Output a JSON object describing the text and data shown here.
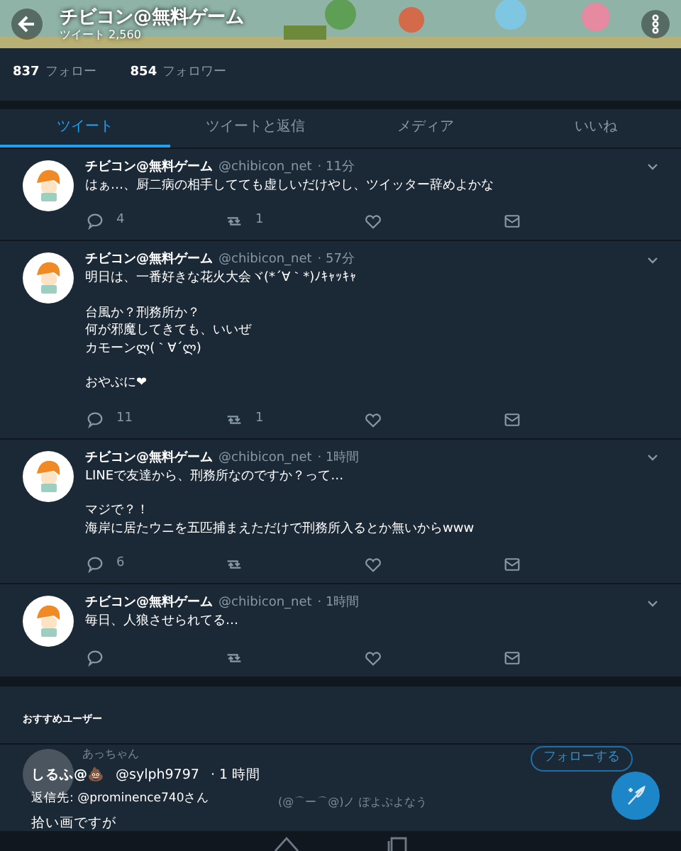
{
  "header": {
    "title": "チビコン@無料ゲーム",
    "subtitle": "ツイート 2,560"
  },
  "stats": [
    {
      "count": "837",
      "label": "フォロー"
    },
    {
      "count": "854",
      "label": "フォロワー"
    }
  ],
  "tabs": [
    {
      "label": "ツイート",
      "selected": true
    },
    {
      "label": "ツイートと返信",
      "selected": false
    },
    {
      "label": "メディア",
      "selected": false
    },
    {
      "label": "いいね",
      "selected": false
    }
  ],
  "tweets": [
    {
      "name": "チビコン@無料ゲーム",
      "handle": "@chibicon_net",
      "time": "· 11分",
      "paragraphs": [
        [
          "はぁ…、厨二病の相手してても虚しいだけやし、ツイッター辞めよかな"
        ]
      ],
      "replies": "4",
      "retweets": "1"
    },
    {
      "name": "チビコン@無料ゲーム",
      "handle": "@chibicon_net",
      "time": "· 57分",
      "paragraphs": [
        [
          "明日は、一番好きな花火大会ヾ(*´∀｀*)ﾉｷｬｯｷｬ"
        ],
        [
          "台風か？刑務所か？",
          "何が邪魔してきても、いいぜ",
          "カモーンლ(｀∀´ლ)"
        ],
        [
          "おやぶに❤"
        ]
      ],
      "replies": "11",
      "retweets": "1"
    },
    {
      "name": "チビコン@無料ゲーム",
      "handle": "@chibicon_net",
      "time": "· 1時間",
      "paragraphs": [
        [
          "LINEで友達から、刑務所なのですか？って…"
        ],
        [
          "マジで？！",
          "海岸に居たウニを五匹捕まえただけで刑務所入るとか無いからwww"
        ]
      ],
      "replies": "6"
    },
    {
      "name": "チビコン@無料ゲーム",
      "handle": "@chibicon_net",
      "time": "· 1時間",
      "paragraphs": [
        [
          "毎日、人狼させられてる…"
        ]
      ]
    }
  ],
  "recommended": {
    "heading": "おすすめユーザー",
    "user": {
      "name": "あっちゃん",
      "bio": "(@⌒ー⌒@)ノ ぽよぷよなう",
      "follow": "フォローする"
    }
  },
  "overlay_tweet": {
    "name": "しるふ@💩",
    "handle": "@sylph9797",
    "time": "· 1 時間",
    "reply_to": "返信先: @prominence740さん",
    "lines": [
      "拾い画ですが"
    ]
  }
}
